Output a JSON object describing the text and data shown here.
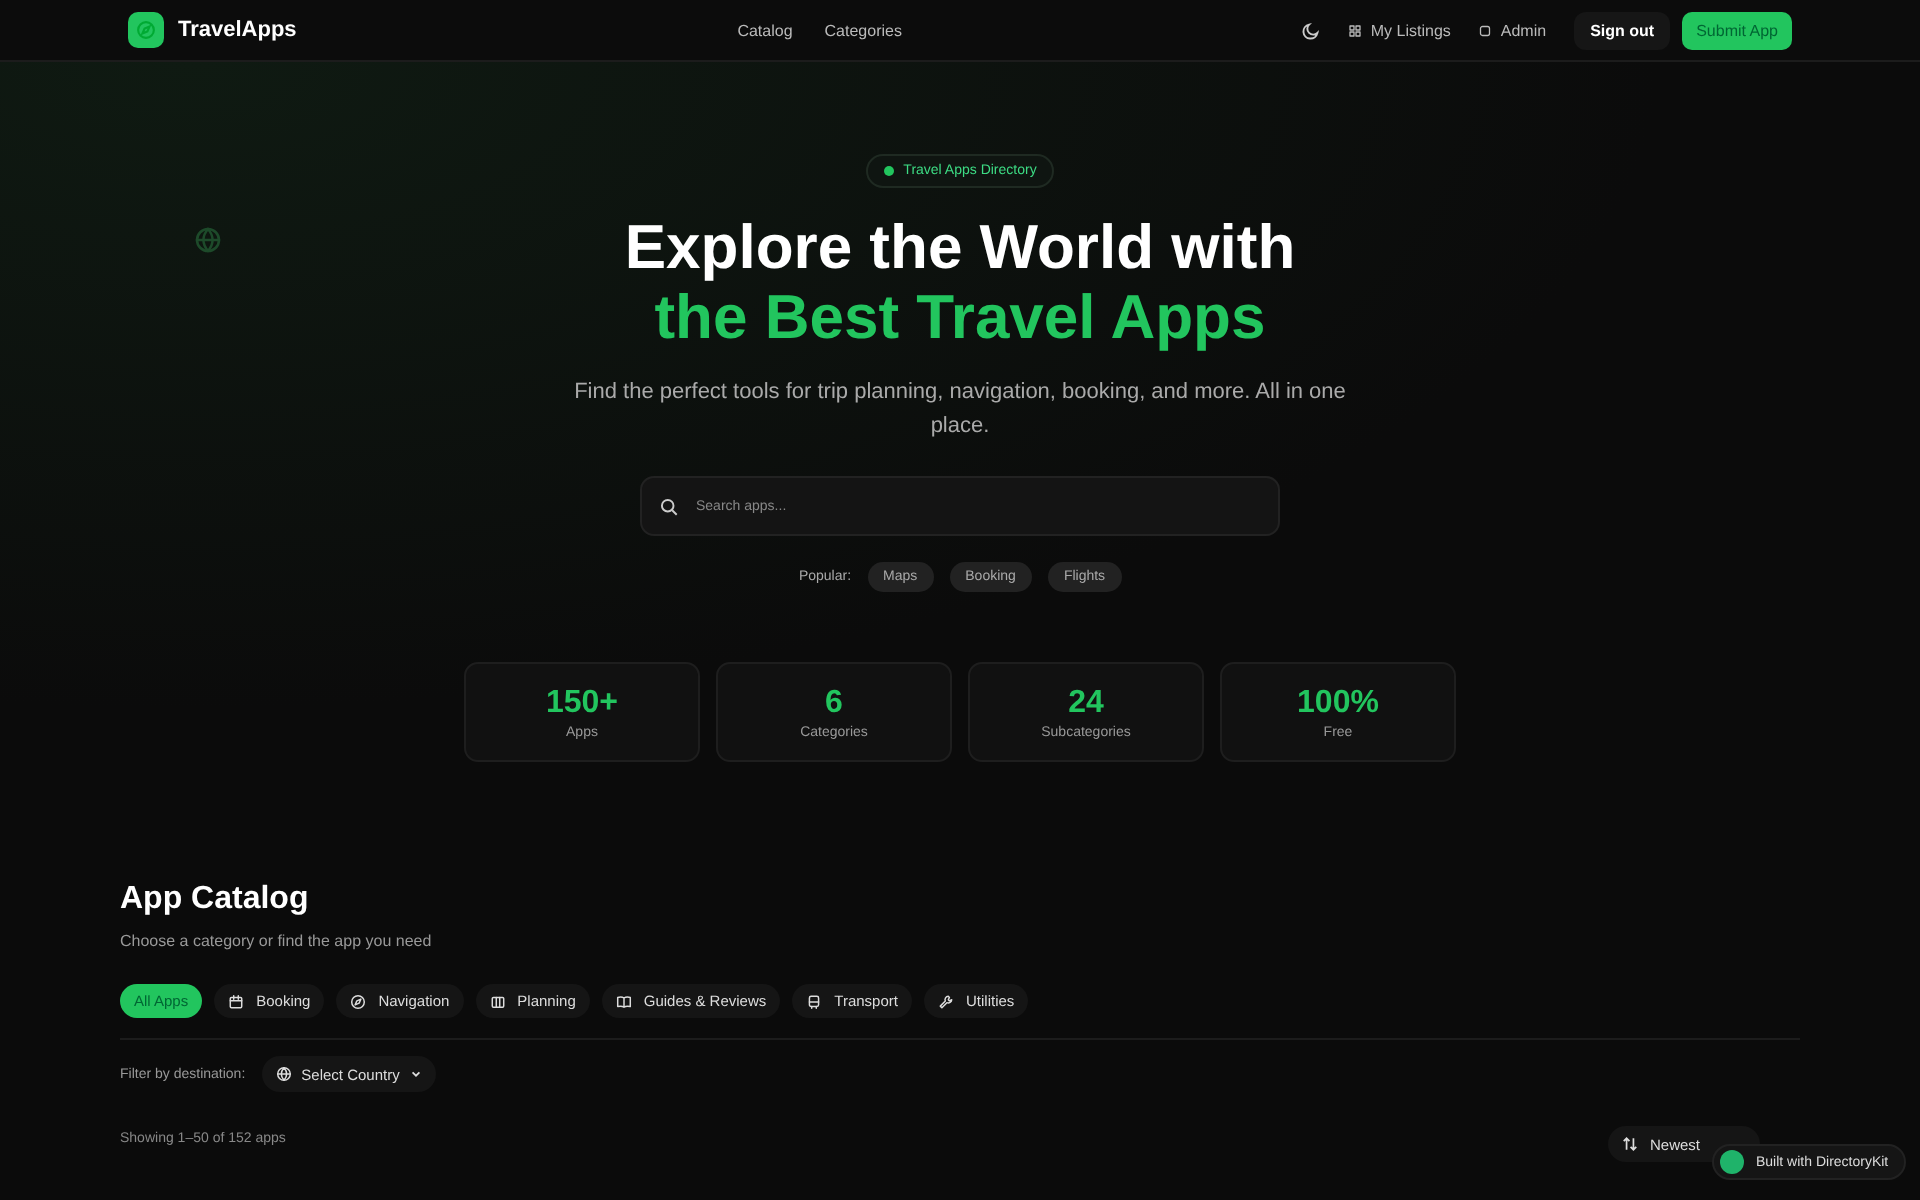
{
  "header": {
    "brand": "TravelApps",
    "nav": [
      "Catalog",
      "Categories"
    ],
    "actions": [
      {
        "kind": "listings",
        "label": "My Listings"
      },
      {
        "kind": "admin",
        "label": "Admin"
      }
    ],
    "sign_out": "Sign out",
    "submit": "Submit App"
  },
  "hero": {
    "badge": "Travel Apps Directory",
    "title_line1": "Explore the World with",
    "title_line2": "the Best Travel Apps",
    "subtitle": "Find the perfect tools for trip planning, navigation, booking, and more. All in one place.",
    "search": {
      "placeholder": "Search apps..."
    },
    "popular_label": "Popular:",
    "popular": [
      "Maps",
      "Booking",
      "Flights"
    ]
  },
  "stats": [
    {
      "value": "150+",
      "label": "Apps"
    },
    {
      "value": "6",
      "label": "Categories"
    },
    {
      "value": "24",
      "label": "Subcategories"
    },
    {
      "value": "100%",
      "label": "Free"
    }
  ],
  "catalog": {
    "title": "App Catalog",
    "subtitle": "Choose a category or find the app you need",
    "categories": [
      {
        "label": "All Apps",
        "kind": "all",
        "selected": true
      },
      {
        "label": "Booking",
        "kind": "calendar",
        "selected": false
      },
      {
        "label": "Navigation",
        "kind": "compass",
        "selected": false
      },
      {
        "label": "Planning",
        "kind": "map",
        "selected": false
      },
      {
        "label": "Guides & Reviews",
        "kind": "book",
        "selected": false
      },
      {
        "label": "Transport",
        "kind": "bus",
        "selected": false
      },
      {
        "label": "Utilities",
        "kind": "wrench",
        "selected": false
      }
    ],
    "filter_label": "Filter by destination:",
    "country": "Select Country",
    "showing": "Showing 1–50 of 152 apps",
    "sort": "Newest"
  },
  "built_badge": "Built with DirectoryKit"
}
